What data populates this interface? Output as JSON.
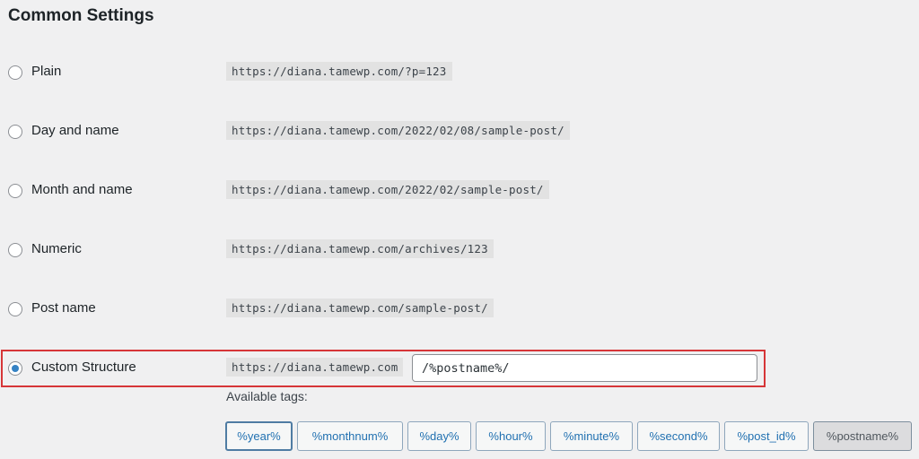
{
  "section_title": "Common Settings",
  "options": [
    {
      "label": "Plain",
      "example": "https://diana.tamewp.com/?p=123",
      "checked": false
    },
    {
      "label": "Day and name",
      "example": "https://diana.tamewp.com/2022/02/08/sample-post/",
      "checked": false
    },
    {
      "label": "Month and name",
      "example": "https://diana.tamewp.com/2022/02/sample-post/",
      "checked": false
    },
    {
      "label": "Numeric",
      "example": "https://diana.tamewp.com/archives/123",
      "checked": false
    },
    {
      "label": "Post name",
      "example": "https://diana.tamewp.com/sample-post/",
      "checked": false
    },
    {
      "label": "Custom Structure",
      "example": "https://diana.tamewp.com",
      "checked": true
    }
  ],
  "custom_structure": {
    "value": "/%postname%/"
  },
  "available_tags": {
    "label": "Available tags:",
    "tags": [
      "%year%",
      "%monthnum%",
      "%day%",
      "%hour%",
      "%minute%",
      "%second%",
      "%post_id%",
      "%postname%"
    ],
    "active": "%postname%",
    "focused": "%year%"
  },
  "colors": {
    "highlight": "#d63638",
    "radio_checked": "#3582c4",
    "tag_text": "#2271b1"
  }
}
